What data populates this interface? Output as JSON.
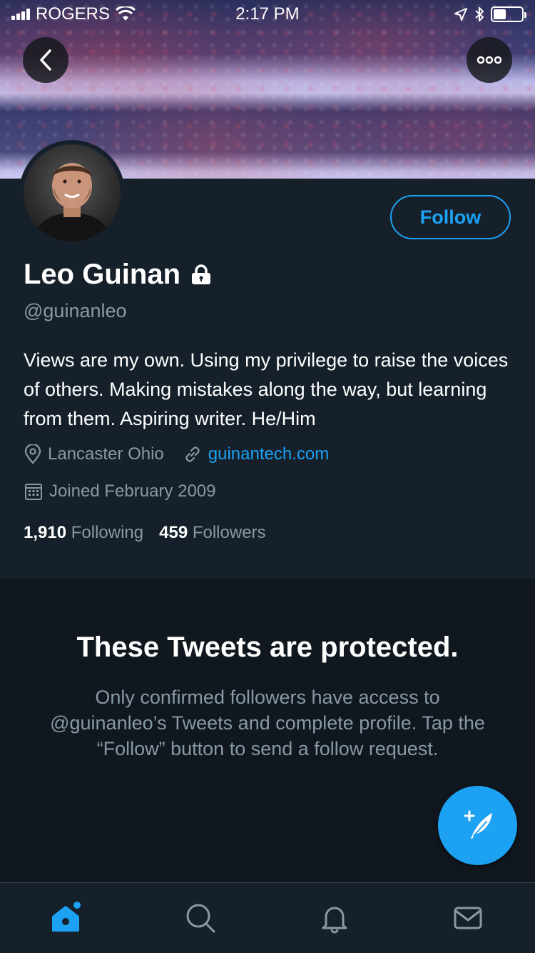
{
  "status_bar": {
    "carrier": "ROGERS",
    "time": "2:17 PM"
  },
  "profile": {
    "name": "Leo Guinan",
    "handle": "@guinanleo",
    "bio": "Views are my own. Using my privilege to raise the voices of others. Making mistakes along the way, but learning from them. Aspiring writer. He/Him",
    "location": "Lancaster Ohio",
    "website": "guinantech.com",
    "joined": "Joined February 2009",
    "following_count": "1,910",
    "following_label": "Following",
    "followers_count": "459",
    "followers_label": "Followers",
    "follow_button": "Follow"
  },
  "protected": {
    "title": "These Tweets are protected.",
    "message": "Only confirmed followers have access to @guinanleo’s Tweets and complete profile. Tap the “Follow” button to send a follow request."
  },
  "tabs": [
    {
      "icon": "home-icon",
      "active": true
    },
    {
      "icon": "search-icon",
      "active": false
    },
    {
      "icon": "bell-icon",
      "active": false
    },
    {
      "icon": "mail-icon",
      "active": false
    }
  ],
  "colors": {
    "accent": "#1da1f2",
    "background": "#15202b",
    "secondary_text": "#8899a6"
  }
}
